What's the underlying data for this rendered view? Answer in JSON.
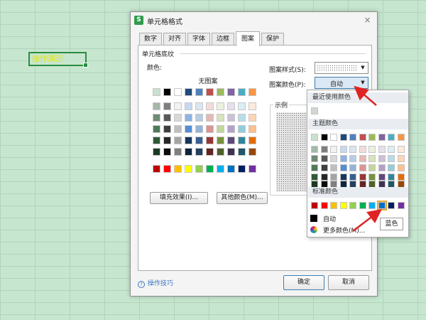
{
  "sheet": {
    "cell_text": "操作演示"
  },
  "dialog": {
    "app_icon": "S",
    "title": "单元格格式",
    "close_icon": "×",
    "tabs": [
      "数字",
      "对齐",
      "字体",
      "边框",
      "图案",
      "保护"
    ],
    "active_tab": "图案"
  },
  "pattern": {
    "group_label": "单元格底纹",
    "color_label": "颜色:",
    "no_pattern": "无图案",
    "fill_effects_button": "填充效果(I)...",
    "more_colors_button": "其他颜色(M)...",
    "pattern_style_label": "图案样式(S):",
    "pattern_color_label": "图案颜色(P):",
    "pattern_color_value": "自动",
    "sample_label": "示例"
  },
  "palette_rows": [
    [
      "#c9e0cf",
      "#000000",
      "#ffffff",
      "#1f497d",
      "#4f81bd",
      "#c0504d",
      "#9bbb59",
      "#8064a2",
      "#4bacc6",
      "#f79646"
    ],
    [
      "#a4b9a9",
      "#7f7f7f",
      "#f2f2f2",
      "#c6d9f0",
      "#dbe5f1",
      "#f2dcdb",
      "#ebf1dd",
      "#e5e0ec",
      "#dbeef3",
      "#fdeada"
    ],
    [
      "#6f8a75",
      "#595959",
      "#d8d8d8",
      "#8db3e2",
      "#b8cce4",
      "#e5b9b7",
      "#d7e3bc",
      "#ccc1d9",
      "#b7dde8",
      "#fbd5b5"
    ],
    [
      "#4f7a58",
      "#3f3f3f",
      "#bfbfbf",
      "#548dd4",
      "#95b3d7",
      "#d99694",
      "#c3d69b",
      "#b2a2c7",
      "#92cddc",
      "#fac08f"
    ],
    [
      "#2f5a38",
      "#262626",
      "#a5a5a5",
      "#17365d",
      "#366092",
      "#953734",
      "#76923c",
      "#5f497a",
      "#31859b",
      "#e36c09"
    ],
    [
      "#1c3a24",
      "#0c0c0c",
      "#7f7f7f",
      "#0f243e",
      "#244061",
      "#632423",
      "#4f6128",
      "#3f3151",
      "#205867",
      "#974806"
    ]
  ],
  "standard_colors": [
    "#c00000",
    "#ff0000",
    "#ffc000",
    "#ffff00",
    "#92d050",
    "#00b050",
    "#00b0f0",
    "#0070c0",
    "#002060",
    "#7030a0"
  ],
  "recent_color": "#d0d6d1",
  "dropdown": {
    "recent_header": "最近使用颜色",
    "theme_header": "主题颜色",
    "standard_header": "标准颜色",
    "auto_label": "自动",
    "more_colors_label": "更多颜色(M)...",
    "more_colors_icon": "palette-icon",
    "tooltip": "蓝色"
  },
  "footer": {
    "tips_label": "操作技巧",
    "tips_icon": "?",
    "ok_button": "确定",
    "cancel_button": "取消"
  },
  "colors": {
    "accent": "#3a76c0",
    "annotation_arrow": "#e02424",
    "selected_outline": "#e8a735"
  }
}
